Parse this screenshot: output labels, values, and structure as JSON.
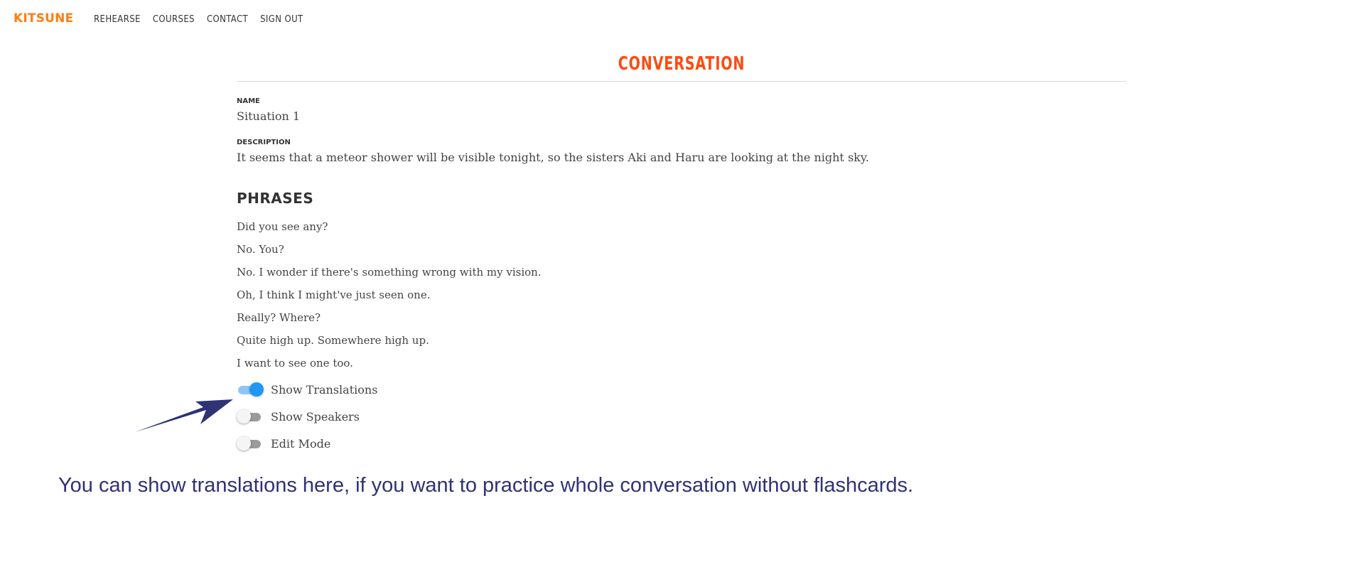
{
  "nav": {
    "brand": "KITSUNE",
    "links": [
      "REHEARSE",
      "COURSES",
      "CONTACT",
      "SIGN OUT"
    ]
  },
  "page": {
    "title": "CONVERSATION"
  },
  "fields": {
    "name_label": "NAME",
    "name_value": "Situation 1",
    "description_label": "DESCRIPTION",
    "description_value": "It seems that a meteor shower will be visible tonight, so the sisters Aki and Haru are looking at the night sky."
  },
  "phrases": {
    "heading": "PHRASES",
    "items": [
      "Did you see any?",
      "No. You?",
      "No. I wonder if there's something wrong with my vision.",
      "Oh, I think I might've just seen one.",
      "Really? Where?",
      "Quite high up. Somewhere high up.",
      "I want to see one too."
    ]
  },
  "toggles": [
    {
      "label": "Show Translations",
      "on": true
    },
    {
      "label": "Show Speakers",
      "on": false
    },
    {
      "label": "Edit Mode",
      "on": false
    }
  ],
  "annotation": {
    "text": "You can show translations here, if you want to practice whole conversation without flashcards.",
    "color": "#2f3274"
  },
  "colors": {
    "brand": "#ff7d0f",
    "title": "#ff4a0f",
    "toggle_on": "#2196f3"
  }
}
